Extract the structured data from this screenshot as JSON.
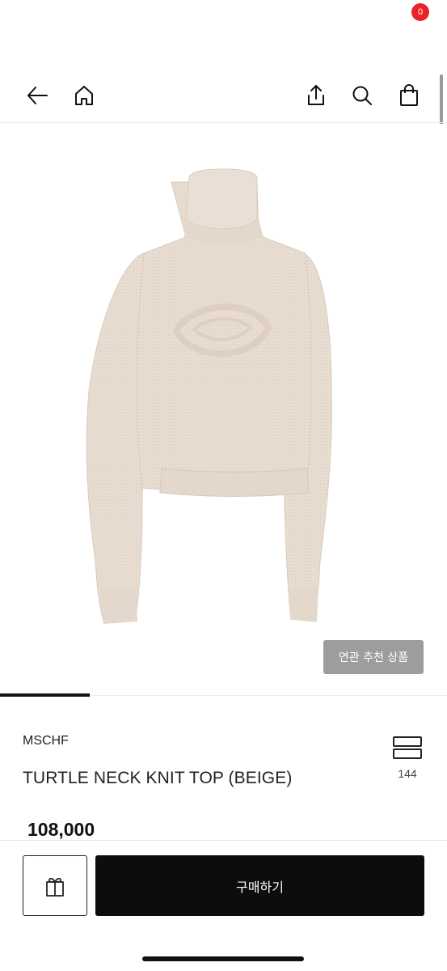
{
  "header": {
    "icons": [
      "arrow-left-icon",
      "home-icon",
      "share-icon",
      "search-icon",
      "shopping-bag-icon"
    ],
    "cart_count": "0",
    "badge_color": "#e8242b"
  },
  "gallery": {
    "related_label": "연관 추천 상품",
    "current_index": 1,
    "total": 5
  },
  "product": {
    "brand": "MSCHF",
    "name": "TURTLE NECK KNIT TOP (BEIGE)",
    "price": "108,000",
    "like_count": "144"
  },
  "actions": {
    "buy_label": "구매하기",
    "gift_icon": "gift-icon"
  },
  "colors": {
    "sweater": "#e9ddd2",
    "buy_button": "#0d0d0d",
    "related_button": "#9d9d9d"
  }
}
